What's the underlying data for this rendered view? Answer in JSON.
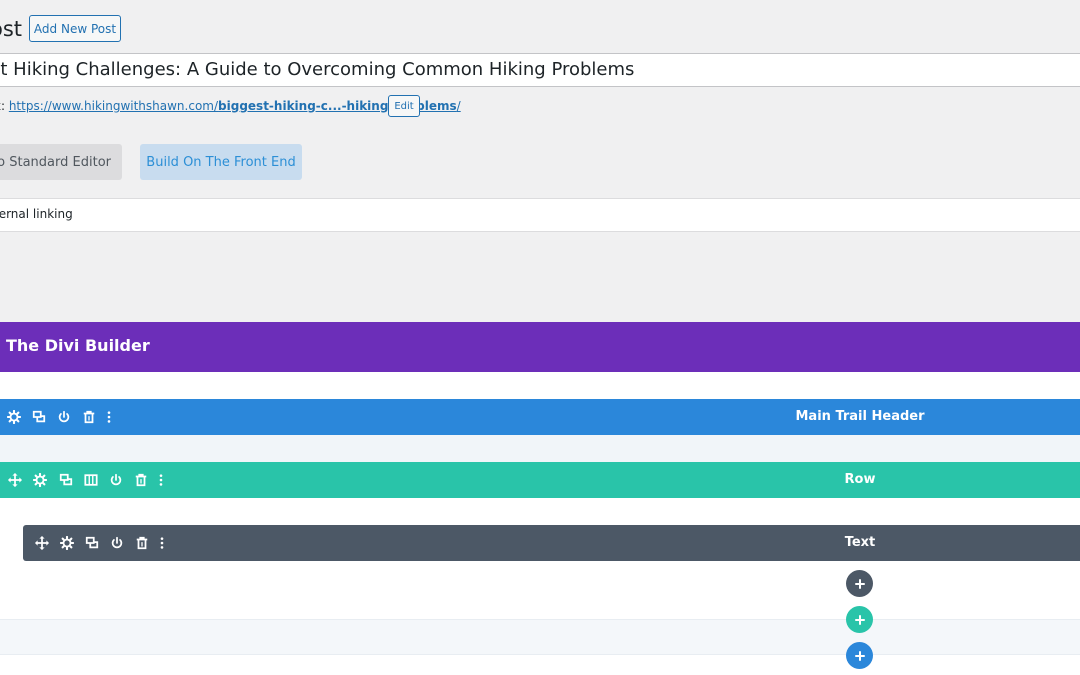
{
  "header": {
    "page_heading": "ost",
    "add_new_label": "Add New Post"
  },
  "post": {
    "title": "st Hiking Challenges: A Guide to Overcoming Common Hiking Problems",
    "permalink_label": "k:",
    "permalink_base": "https://www.hikingwithshawn.com/",
    "permalink_slug": "biggest-hiking-c...-hiking-problems",
    "permalink_trail": "/",
    "edit_label": "Edit"
  },
  "editor_buttons": {
    "standard_editor_label": "To Standard Editor",
    "front_end_label": "Build On The Front End"
  },
  "linking": {
    "label": "ternal linking"
  },
  "divi": {
    "title": "The Divi Builder",
    "section_label": "Main Trail Header",
    "row_label": "Row",
    "module_label": "Text",
    "colors": {
      "header": "#6c2eb9",
      "section": "#2b87da",
      "row": "#29c4a9",
      "module": "#4c5866"
    },
    "section_icons": [
      "gear-icon",
      "duplicate-icon",
      "power-icon",
      "trash-icon",
      "more-icon"
    ],
    "row_icons": [
      "move-icon",
      "gear-icon",
      "duplicate-icon",
      "columns-icon",
      "power-icon",
      "trash-icon",
      "more-icon"
    ],
    "module_icons": [
      "move-icon",
      "gear-icon",
      "duplicate-icon",
      "power-icon",
      "trash-icon",
      "more-icon"
    ],
    "add_buttons": [
      {
        "name": "add-module-button",
        "symbol": "+",
        "color": "#4c5866"
      },
      {
        "name": "add-row-button",
        "symbol": "+",
        "color": "#29c4a9"
      },
      {
        "name": "add-section-button",
        "symbol": "+",
        "color": "#2b87da"
      }
    ]
  }
}
